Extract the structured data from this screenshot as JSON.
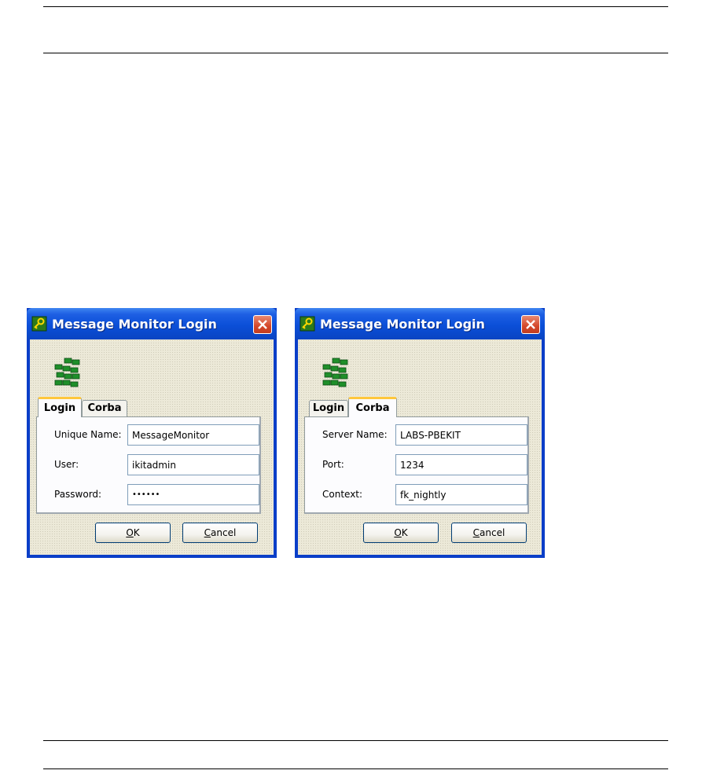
{
  "dialogs": [
    {
      "title": "Message Monitor Login",
      "tabs": [
        {
          "label": "Login"
        },
        {
          "label": "Corba"
        }
      ],
      "active_tab": 0,
      "fields": [
        {
          "label": "Unique Name:",
          "value": "MessageMonitor"
        },
        {
          "label": "User:",
          "value": "ikitadmin"
        },
        {
          "label": "Password:",
          "value": "••••••"
        }
      ],
      "ok": {
        "mnemonic": "O",
        "rest": "K"
      },
      "cancel": {
        "mnemonic": "C",
        "rest": "ancel"
      }
    },
    {
      "title": "Message Monitor Login",
      "tabs": [
        {
          "label": "Login"
        },
        {
          "label": "Corba"
        }
      ],
      "active_tab": 1,
      "fields": [
        {
          "label": "Server Name:",
          "value": "LABS-PBEKIT"
        },
        {
          "label": "Port:",
          "value": "1234"
        },
        {
          "label": "Context:",
          "value": "fk_nightly"
        }
      ],
      "ok": {
        "mnemonic": "O",
        "rest": "K"
      },
      "cancel": {
        "mnemonic": "C",
        "rest": "ancel"
      }
    }
  ],
  "colors": {
    "titlebar": "#0b4fd8",
    "client": "#ece9d8",
    "close": "#d4472a",
    "active_tab_accent": "#ffc73c",
    "logo_green": "#1f8f2a"
  },
  "icons": {
    "title": "key-icon",
    "close": "close-icon",
    "app": "message-monitor-logo-icon"
  }
}
